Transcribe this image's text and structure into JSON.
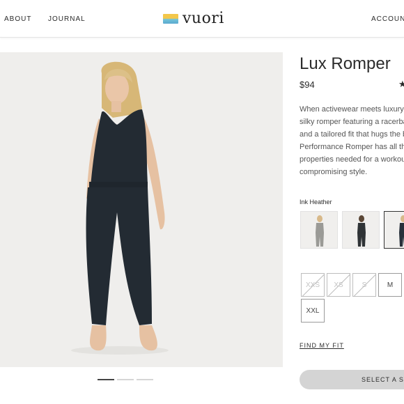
{
  "header": {
    "nav_left": [
      "ABOUT",
      "JOURNAL"
    ],
    "brand": "vuori",
    "nav_right": "ACCOUNT"
  },
  "product": {
    "title": "Lux Romper",
    "price": "$94",
    "description_lines": [
      "When activewear meets luxury, y",
      "silky romper featuring a racerbac",
      "and a tailored fit that hugs the bo",
      "Performance Romper has all the",
      "properties needed for a workout",
      "compromising style."
    ],
    "color_label": "Ink Heather",
    "swatches": [
      {
        "name": "gray",
        "color": "#9a9a96",
        "selected": false
      },
      {
        "name": "charcoal",
        "color": "#2f3336",
        "selected": false
      },
      {
        "name": "ink-heather",
        "color": "#27303a",
        "selected": true
      }
    ],
    "sizes": [
      {
        "label": "XXS",
        "available": false
      },
      {
        "label": "XS",
        "available": false
      },
      {
        "label": "S",
        "available": false
      },
      {
        "label": "M",
        "available": true
      },
      {
        "label": "XXL",
        "available": true
      }
    ],
    "find_fit": "FIND MY FIT",
    "select_size": "SELECT A SIZ"
  },
  "gallery": {
    "slide_count": 3,
    "active_index": 0
  },
  "colors": {
    "outfit": "#232b33",
    "image_bg": "#efeeec",
    "button_bg": "#d4d4d4"
  }
}
